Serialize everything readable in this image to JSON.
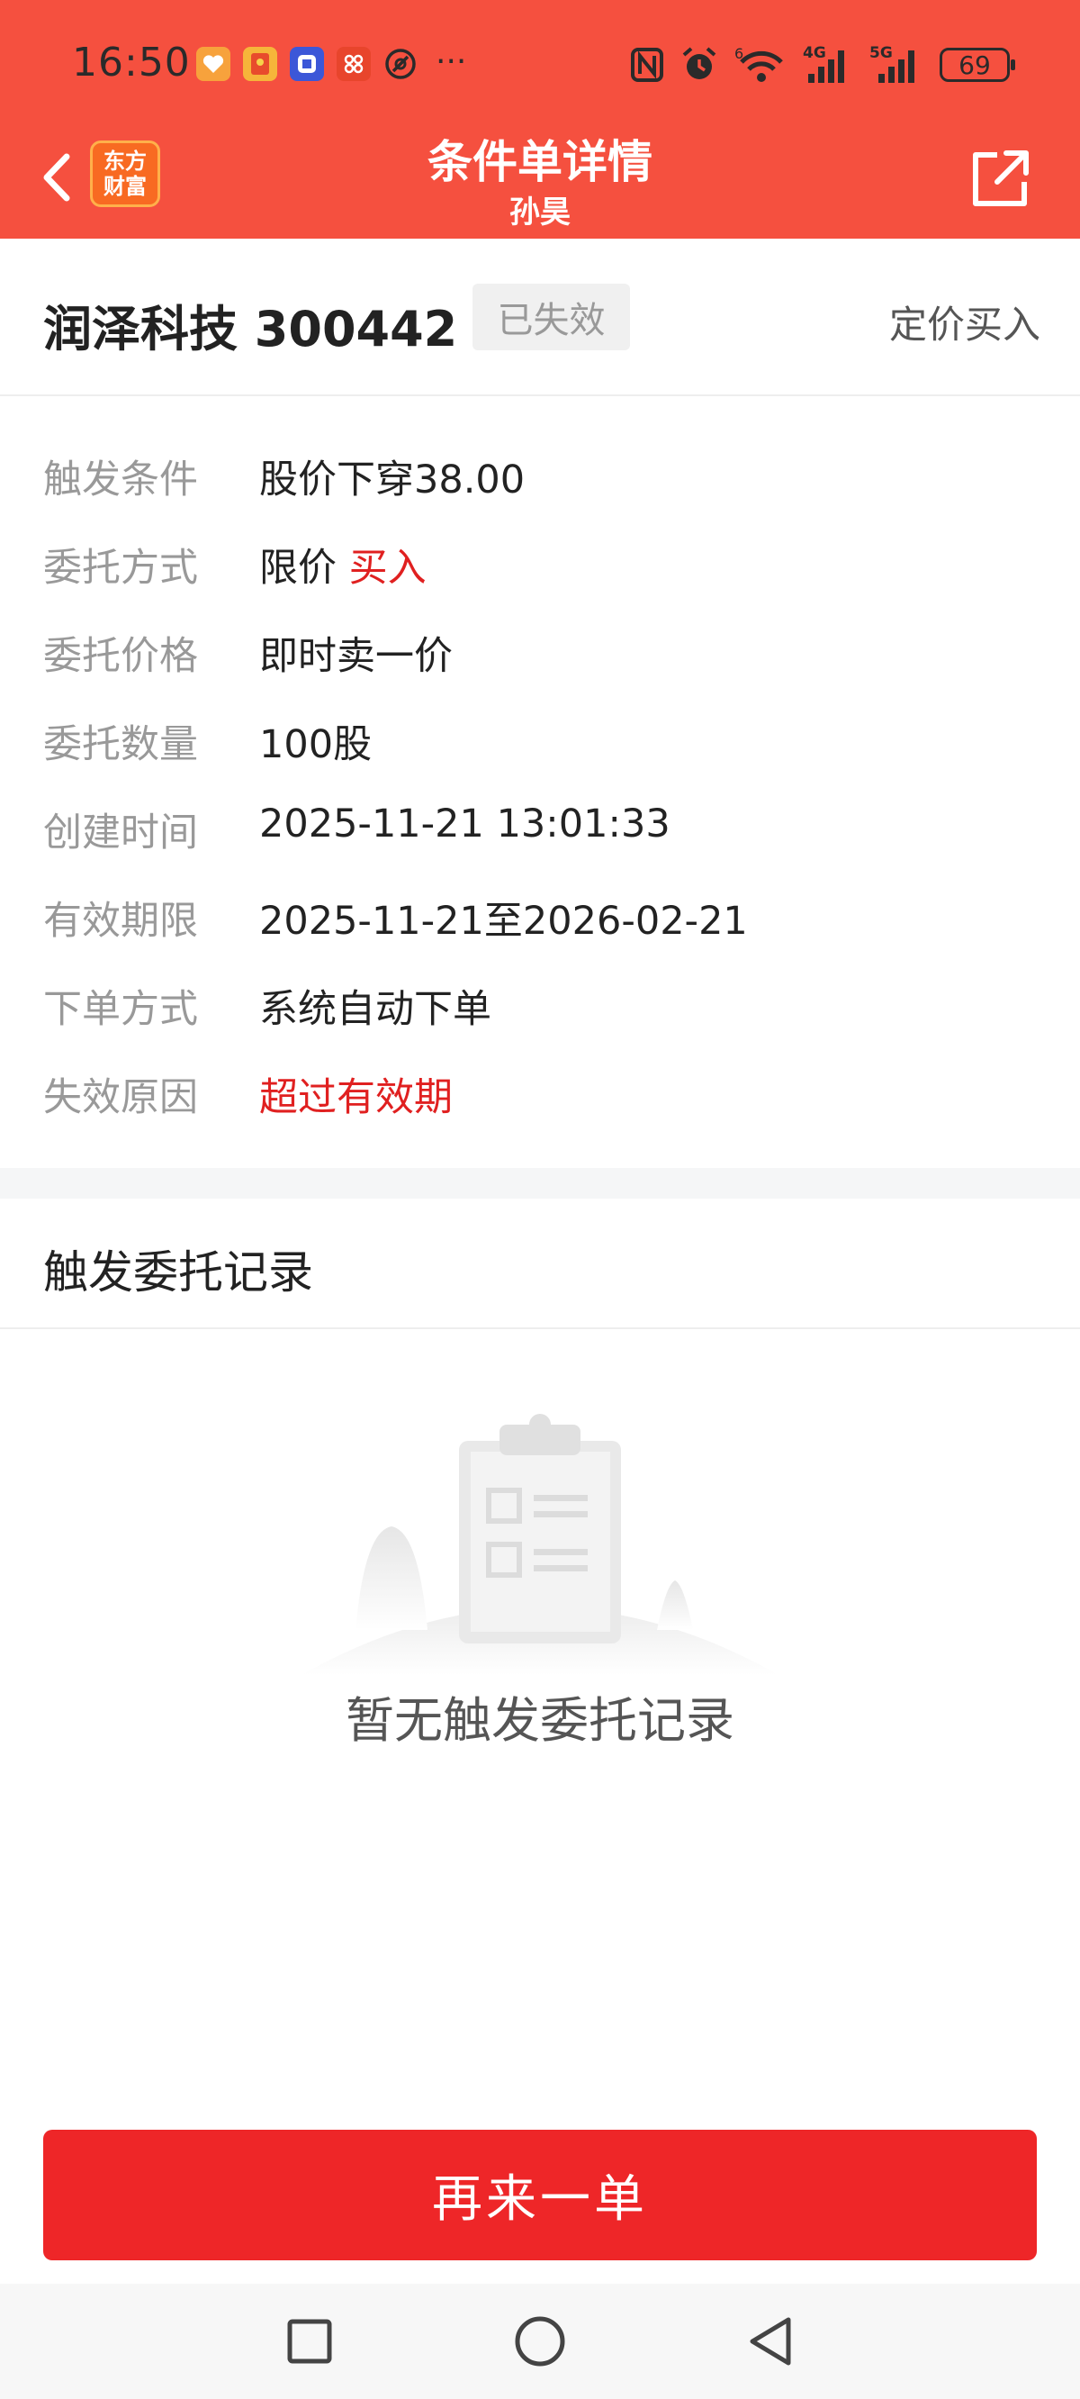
{
  "status_bar": {
    "time": "16:50",
    "more": "···",
    "battery": "69",
    "net_4g": "4G",
    "net_5g": "5G",
    "wifi_badge": "6"
  },
  "header": {
    "title": "条件单详情",
    "subtitle": "孙昊",
    "logo_line1": "东方",
    "logo_line2": "财富",
    "accent_color": "#f5503f"
  },
  "stock": {
    "name_code": "润泽科技 300442",
    "status": "已失效",
    "order_type": "定价买入"
  },
  "details": [
    {
      "label": "触发条件",
      "value": "股价下穿38.00"
    },
    {
      "label": "委托方式",
      "value": "限价",
      "value_highlight": "买入"
    },
    {
      "label": "委托价格",
      "value": "即时卖一价"
    },
    {
      "label": "委托数量",
      "value": "100股"
    },
    {
      "label": "创建时间",
      "value": "2025-11-21 13:01:33"
    },
    {
      "label": "有效期限",
      "value": "2025-11-21至2026-02-21"
    },
    {
      "label": "下单方式",
      "value": "系统自动下单"
    },
    {
      "label": "失效原因",
      "value": "超过有效期"
    }
  ],
  "records": {
    "title": "触发委托记录",
    "empty_text": "暂无触发委托记录"
  },
  "actions": {
    "again_label": "再来一单",
    "button_color": "#ee2628"
  },
  "icons": {
    "back": "chevron-left-icon",
    "share": "share-external-icon",
    "nav_recent": "square-icon",
    "nav_home": "circle-icon",
    "nav_back": "triangle-back-icon"
  }
}
